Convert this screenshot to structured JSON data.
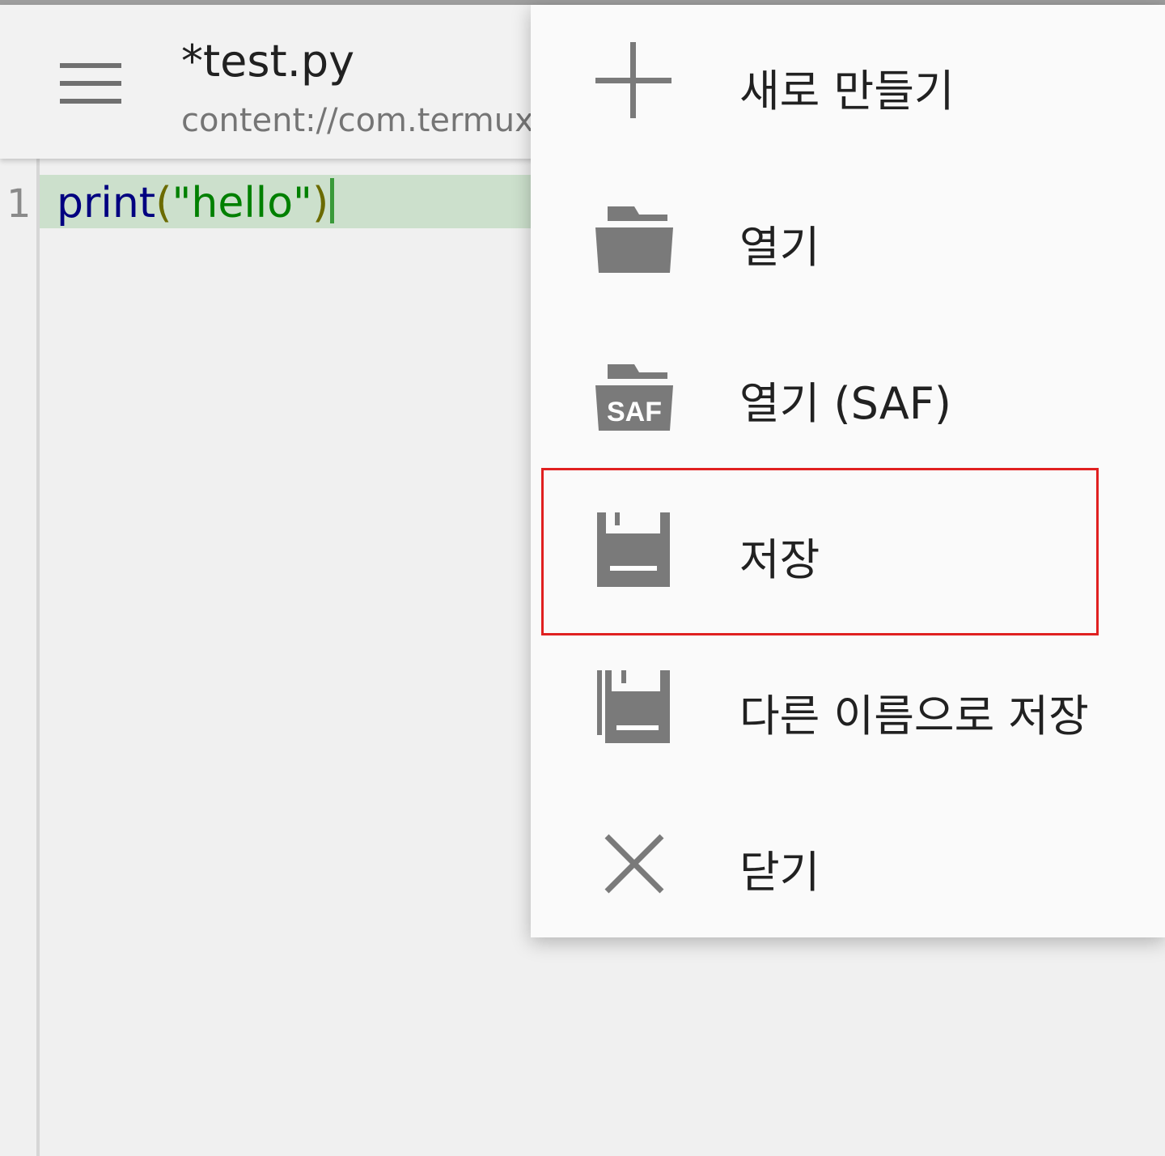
{
  "toolbar": {
    "menu_icon": "hamburger-menu-icon",
    "title": "*test.py",
    "subtitle": "content://com.termux.documents/tree/test.py"
  },
  "editor": {
    "line_number": "1",
    "code": {
      "func": "print",
      "open_paren": "(",
      "string": "\"hello\"",
      "close_paren": ")"
    }
  },
  "menu": {
    "items": [
      {
        "label": "새로 만들기",
        "icon": "plus-icon"
      },
      {
        "label": "열기",
        "icon": "folder-icon"
      },
      {
        "label": "열기 (SAF)",
        "icon": "folder-saf-icon"
      },
      {
        "label": "저장",
        "icon": "save-icon"
      },
      {
        "label": "다른 이름으로 저장",
        "icon": "save-as-icon"
      },
      {
        "label": "닫기",
        "icon": "close-icon"
      }
    ],
    "highlighted_index": 3
  },
  "colors": {
    "icon": "#7a7a7a",
    "highlight": "#e02020",
    "current_line": "#cce0cc"
  }
}
